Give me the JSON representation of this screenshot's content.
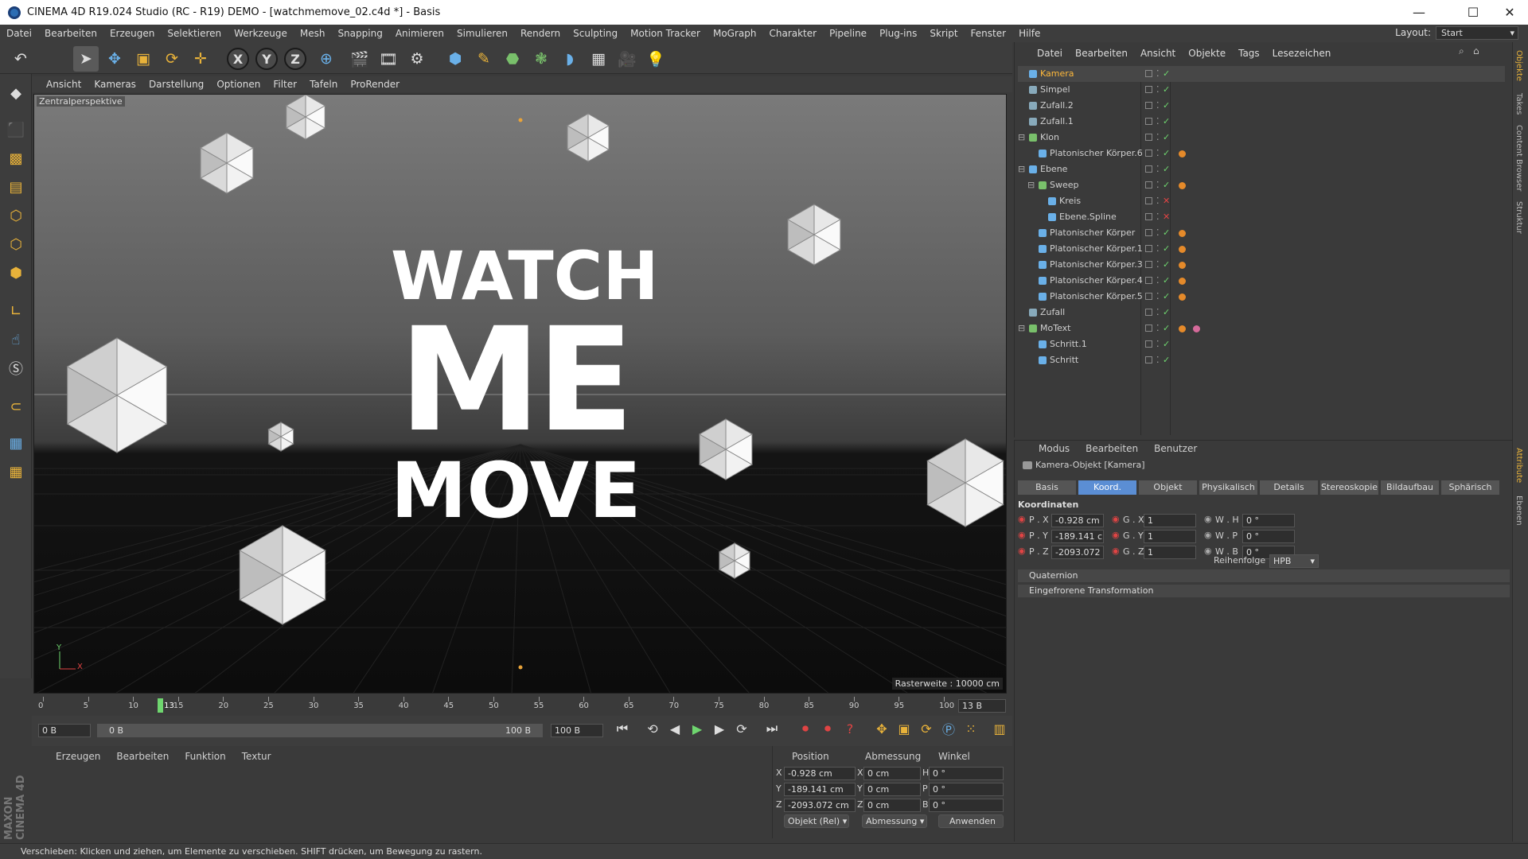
{
  "window": {
    "title": "CINEMA 4D R19.024 Studio (RC - R19) DEMO - [watchmemove_02.c4d *] - Basis"
  },
  "menu": [
    "Datei",
    "Bearbeiten",
    "Erzeugen",
    "Selektieren",
    "Werkzeuge",
    "Mesh",
    "Snapping",
    "Animieren",
    "Simulieren",
    "Rendern",
    "Sculpting",
    "Motion Tracker",
    "MoGraph",
    "Charakter",
    "Pipeline",
    "Plug-ins",
    "Skript",
    "Fenster",
    "Hilfe"
  ],
  "layout": {
    "label": "Layout:",
    "value": "Start"
  },
  "toolbar_icons": [
    "undo-icon",
    "pointer-icon",
    "move-icon",
    "scale-icon",
    "rotate-icon",
    "cross-icon",
    "x-axis-icon",
    "y-axis-icon",
    "z-axis-icon",
    "world-icon",
    "render-view-icon",
    "render-icon",
    "render-settings-icon",
    "cube-icon",
    "pen-icon",
    "subdivision-icon",
    "cloner-icon",
    "deformer-icon",
    "floor-icon",
    "camera-icon",
    "light-icon"
  ],
  "viewport": {
    "menu": [
      "Ansicht",
      "Kameras",
      "Darstellung",
      "Optionen",
      "Filter",
      "Tafeln",
      "ProRender"
    ],
    "label": "Zentralperspektive",
    "raster": "Rasterweite : 10000 cm",
    "text_lines": [
      "WATCH",
      "ME",
      "MOVE"
    ],
    "axis_y": "Y",
    "axis_x": "X"
  },
  "timeline": {
    "ticks": [
      "0",
      "5",
      "10",
      "15",
      "20",
      "25",
      "30",
      "35",
      "40",
      "45",
      "50",
      "55",
      "60",
      "65",
      "70",
      "75",
      "80",
      "85",
      "90",
      "95",
      "100"
    ],
    "current": "13",
    "frame_display": "13 B",
    "start": "0 B",
    "range_start": "0 B",
    "range_end": "100 B",
    "end": "100 B"
  },
  "material": {
    "menu": [
      "Erzeugen",
      "Bearbeiten",
      "Funktion",
      "Textur"
    ]
  },
  "coords": {
    "headers": [
      "Position",
      "Abmessung",
      "Winkel"
    ],
    "rows": [
      {
        "a": "X",
        "pos": "-0.928 cm",
        "b": "X",
        "size": "0 cm",
        "c": "H",
        "rot": "0 °"
      },
      {
        "a": "Y",
        "pos": "-189.141 cm",
        "b": "Y",
        "size": "0 cm",
        "c": "P",
        "rot": "0 °"
      },
      {
        "a": "Z",
        "pos": "-2093.072 cm",
        "b": "Z",
        "size": "0 cm",
        "c": "B",
        "rot": "0 °"
      }
    ],
    "mode": "Objekt (Rel)",
    "size_mode": "Abmessung",
    "apply": "Anwenden"
  },
  "objects": {
    "menu": [
      "Datei",
      "Bearbeiten",
      "Ansicht",
      "Objekte",
      "Tags",
      "Lesezeichen"
    ],
    "items": [
      {
        "name": "Kamera",
        "indent": 0,
        "selected": true,
        "color": "#6ab0e8"
      },
      {
        "name": "Simpel",
        "indent": 0,
        "color": "#8ab"
      },
      {
        "name": "Zufall.2",
        "indent": 0,
        "color": "#8ab"
      },
      {
        "name": "Zufall.1",
        "indent": 0,
        "color": "#8ab"
      },
      {
        "name": "Klon",
        "indent": 0,
        "color": "#79c06b"
      },
      {
        "name": "Platonischer Körper.6",
        "indent": 1,
        "color": "#6ab0e8"
      },
      {
        "name": "Ebene",
        "indent": 0,
        "color": "#6ab0e8"
      },
      {
        "name": "Sweep",
        "indent": 1,
        "color": "#79c06b"
      },
      {
        "name": "Kreis",
        "indent": 2,
        "color": "#6ab0e8"
      },
      {
        "name": "Ebene.Spline",
        "indent": 2,
        "color": "#6ab0e8"
      },
      {
        "name": "Platonischer Körper",
        "indent": 1,
        "color": "#6ab0e8"
      },
      {
        "name": "Platonischer Körper.1",
        "indent": 1,
        "color": "#6ab0e8"
      },
      {
        "name": "Platonischer Körper.3",
        "indent": 1,
        "color": "#6ab0e8"
      },
      {
        "name": "Platonischer Körper.4",
        "indent": 1,
        "color": "#6ab0e8"
      },
      {
        "name": "Platonischer Körper.5",
        "indent": 1,
        "color": "#6ab0e8"
      },
      {
        "name": "Zufall",
        "indent": 0,
        "color": "#8ab"
      },
      {
        "name": "MoText",
        "indent": 0,
        "color": "#79c06b"
      },
      {
        "name": "Schritt.1",
        "indent": 1,
        "color": "#6ab0e8"
      },
      {
        "name": "Schritt",
        "indent": 1,
        "color": "#6ab0e8"
      }
    ]
  },
  "attributes": {
    "menu": [
      "Modus",
      "Bearbeiten",
      "Benutzer"
    ],
    "title": "Kamera-Objekt [Kamera]",
    "tabs": [
      "Basis",
      "Koord.",
      "Objekt",
      "Physikalisch",
      "Details",
      "Stereoskopie",
      "Bildaufbau",
      "Sphärisch"
    ],
    "active_tab": "Koord.",
    "section": "Koordinaten",
    "rows": [
      {
        "p_label": "P . X",
        "p_val": "-0.928 cm",
        "s_label": "G . X",
        "s_val": "1",
        "r_label": "W . H",
        "r_val": "0 °"
      },
      {
        "p_label": "P . Y",
        "p_val": "-189.141 c",
        "s_label": "G . Y",
        "s_val": "1",
        "r_label": "W . P",
        "r_val": "0 °"
      },
      {
        "p_label": "P . Z",
        "p_val": "-2093.072",
        "s_label": "G . Z",
        "s_val": "1",
        "r_label": "W . B",
        "r_val": "0 °"
      }
    ],
    "order_label": "Reihenfolge",
    "order_value": "HPB",
    "collapsed": [
      "Quaternion",
      "Eingefrorene Transformation"
    ]
  },
  "right_tabs": [
    "Objekte",
    "Takes",
    "Content Browser",
    "Struktur",
    "Attribute",
    "Ebenen"
  ],
  "status": "Verschieben: Klicken und ziehen, um Elemente zu verschieben. SHIFT drücken, um Bewegung zu rastern.",
  "brand": "MAXON CINEMA 4D"
}
